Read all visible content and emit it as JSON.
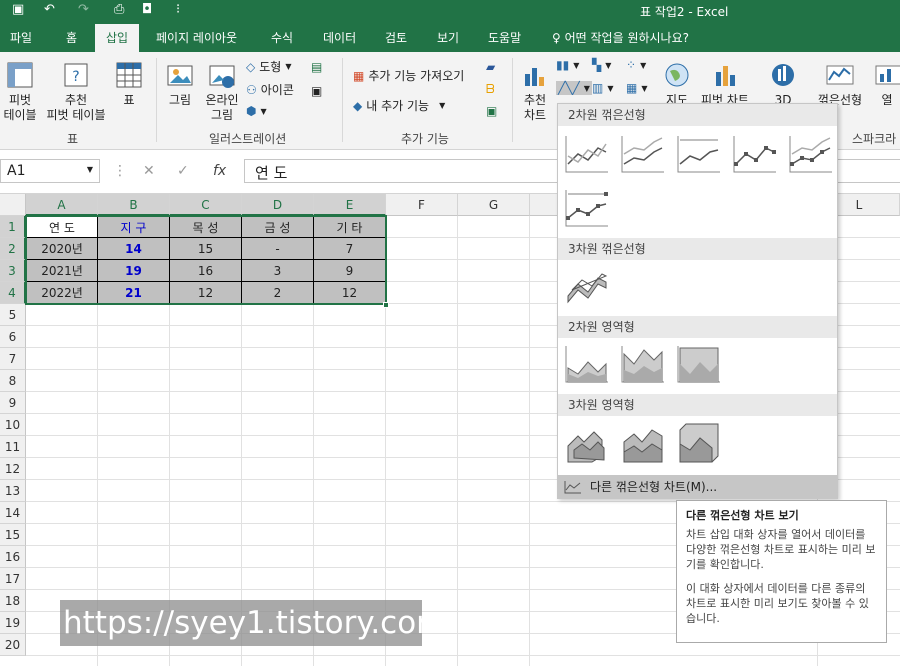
{
  "window": {
    "title": "표 작업2  -  Excel"
  },
  "tabs": [
    "파일",
    "홈",
    "삽입",
    "페이지 레이아웃",
    "수식",
    "데이터",
    "검토",
    "보기",
    "도움말",
    "어떤 작업을 원하시나요?"
  ],
  "ribbon": {
    "pivot_table": "피벗\n테이블",
    "recommended_pivot": "추천\n피벗 테이블",
    "table": "표",
    "group_tables": "표",
    "picture": "그림",
    "online_picture": "온라인\n그림",
    "shapes": "도형",
    "icons": "아이콘",
    "group_illustrations": "일러스트레이션",
    "get_addins": "추가 기능 가져오기",
    "my_addins": "내 추가 기능",
    "group_addins": "추가 기능",
    "recommended_charts": "추천\n차트",
    "maps": "지도",
    "pivot_chart": "피벗 차트",
    "three_d": "3D",
    "line_sparkline": "꺾은선형",
    "column_sparkline": "열",
    "group_sparklines": "스파크라"
  },
  "formula_bar": {
    "name_box": "A1",
    "cancel": "✕",
    "enter": "✓",
    "fx": "fx",
    "value": "연 도"
  },
  "columns": [
    "A",
    "B",
    "C",
    "D",
    "E",
    "F",
    "G",
    "L"
  ],
  "rows": [
    "1",
    "2",
    "3",
    "4",
    "5",
    "6",
    "7",
    "8",
    "9",
    "10",
    "11",
    "12",
    "13",
    "14",
    "15",
    "16",
    "17",
    "18",
    "19",
    "20"
  ],
  "table": {
    "header": [
      "연 도",
      "지 구",
      "목 성",
      "금 성",
      "기 타"
    ],
    "rows": [
      [
        "2020년",
        "14",
        "15",
        "-",
        "7"
      ],
      [
        "2021년",
        "19",
        "16",
        "3",
        "9"
      ],
      [
        "2022년",
        "21",
        "12",
        "2",
        "12"
      ]
    ]
  },
  "dropdown": {
    "section_2d_line": "2차원 꺾은선형",
    "section_3d_line": "3차원 꺾은선형",
    "section_2d_area": "2차원 영역형",
    "section_3d_area": "3차원 영역형",
    "more": "다른 꺾은선형 차트(M)..."
  },
  "tooltip": {
    "title": "다른 꺾은선형 차트 보기",
    "line1": "차트 삽입 대화 상자를 열어서 데이터를 다양한 꺾은선형 차트로 표시하는 미리 보기를 확인합니다.",
    "line2": "이 대화 상자에서 데이터를 다른 종류의 차트로 표시한 미리 보기도 찾아볼 수 있습니다."
  },
  "watermark": "https://syey1.tistory.com",
  "colors": {
    "excel_green": "#217346",
    "header_fill": "#c0c0c0",
    "blue_text": "#0000cc"
  }
}
